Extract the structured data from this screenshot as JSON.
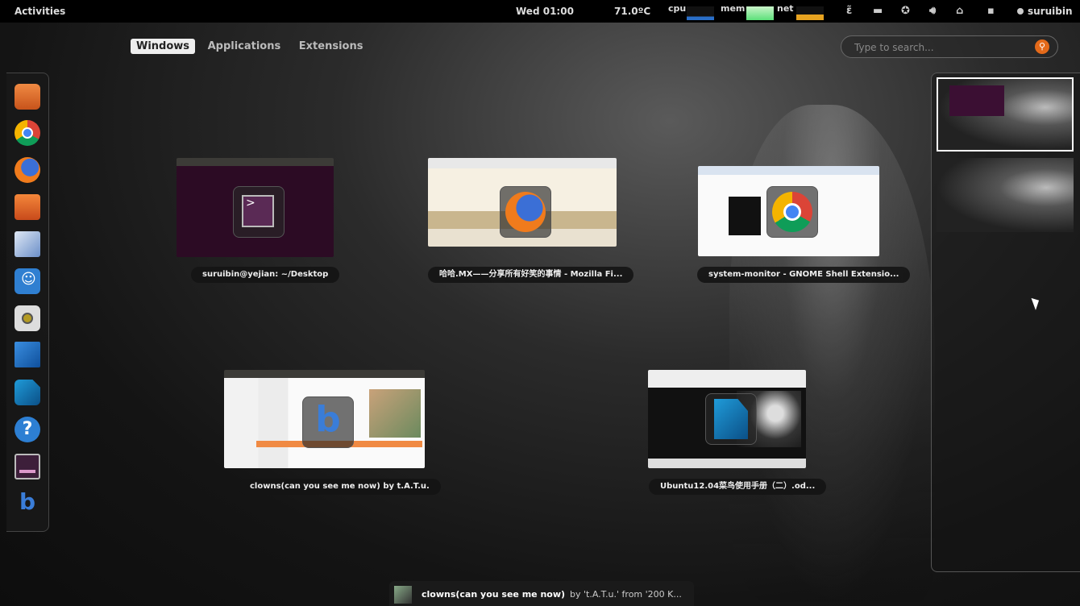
{
  "topbar": {
    "activities": "Activities",
    "clock": "Wed 01:00",
    "temperature": "71.0ºC",
    "cpu_label": "cpu",
    "mem_label": "mem",
    "net_label": "net",
    "user": "suruibin",
    "tray_icons": [
      "bluetooth-icon",
      "folder-icon",
      "accessibility-icon",
      "volume-icon",
      "network-icon",
      "battery-icon"
    ]
  },
  "overview_tabs": [
    {
      "label": "Windows",
      "active": true
    },
    {
      "label": "Applications",
      "active": false
    },
    {
      "label": "Extensions",
      "active": false
    }
  ],
  "search": {
    "placeholder": "Type to search..."
  },
  "dash_apps": [
    "home-folder-icon",
    "chrome-icon",
    "firefox-icon",
    "software-center-icon",
    "mail-icon",
    "empathy-icon",
    "speaker-icon",
    "photos-icon",
    "libreoffice-icon",
    "help-icon",
    "terminal-icon",
    "banshee-icon"
  ],
  "windows": [
    {
      "caption": "suruibin@yejian: ~/Desktop",
      "app": "terminal"
    },
    {
      "caption": "哈哈.MX——分享所有好笑的事情 - Mozilla Fi...",
      "app": "firefox"
    },
    {
      "caption": "system-monitor - GNOME Shell Extensio...",
      "app": "chrome"
    },
    {
      "caption": "clowns(can you see me now) by t.A.T.u.",
      "app": "banshee"
    },
    {
      "caption": "Ubuntu12.04菜鸟使用手册（二）.od...",
      "app": "libreoffice"
    }
  ],
  "notification": {
    "title": "clowns(can you see me now)",
    "rest": "by 't.A.T.u.' from '200 K..."
  },
  "colors": {
    "accent": "#e46a1a",
    "bar": "#000000"
  }
}
